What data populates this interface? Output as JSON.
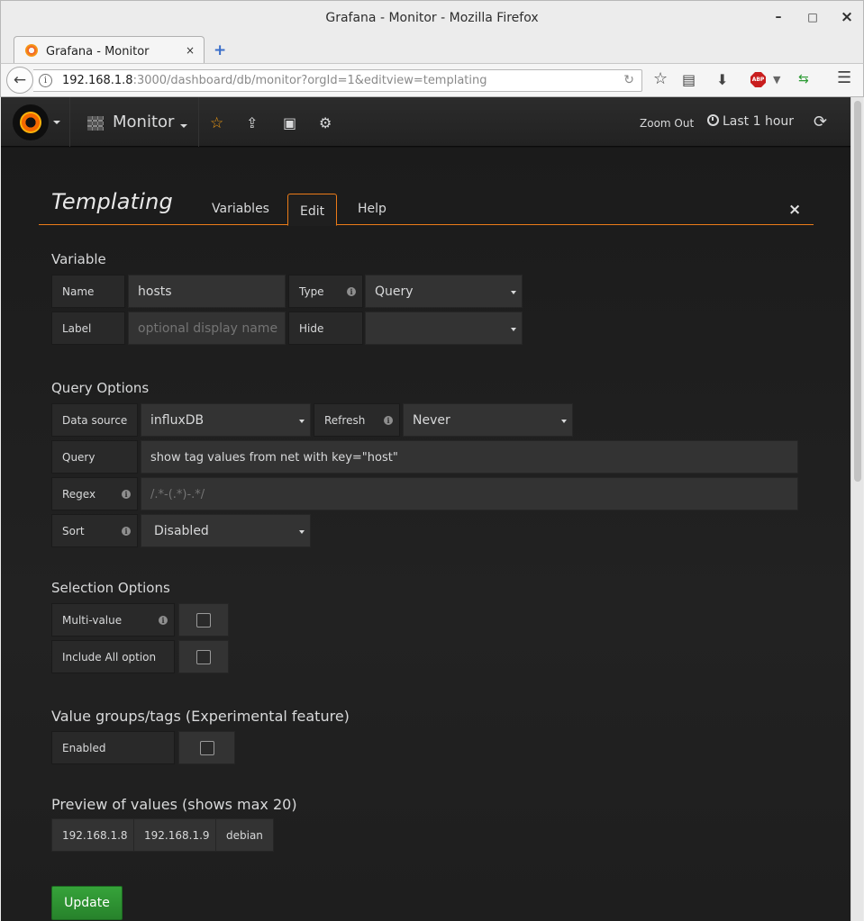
{
  "window": {
    "title": "Grafana - Monitor - Mozilla Firefox",
    "minimize": "–",
    "maximize": "□",
    "close": "×"
  },
  "browser": {
    "tab_label": "Grafana - Monitor",
    "tab_close": "×",
    "new_tab": "+",
    "back": "←",
    "url_host": "192.168.1.8",
    "url_rest": ":3000/dashboard/db/monitor?orgId=1&editview=templating",
    "reload": "↻",
    "icons": [
      "bookmark-star-icon",
      "reader-view-icon",
      "download-icon",
      "adblock-plus-icon",
      "sync-arrows-icon",
      "hamburger-menu-icon"
    ],
    "abp_label": "ABP"
  },
  "topnav": {
    "dashboard_title": "Monitor",
    "zoom_out": "Zoom Out",
    "time_range": "Last 1 hour"
  },
  "templating": {
    "title": "Templating",
    "tabs": {
      "variables": "Variables",
      "edit": "Edit",
      "help": "Help"
    },
    "close": "×",
    "variable": {
      "heading": "Variable",
      "name_label": "Name",
      "name_value": "hosts",
      "type_label": "Type",
      "type_value": "Query",
      "label_label": "Label",
      "label_placeholder": "optional display name",
      "hide_label": "Hide",
      "hide_value": ""
    },
    "query_options": {
      "heading": "Query Options",
      "datasource_label": "Data source",
      "datasource_value": "influxDB",
      "refresh_label": "Refresh",
      "refresh_value": "Never",
      "query_label": "Query",
      "query_value": "show tag values from net with key=\"host\"",
      "regex_label": "Regex",
      "regex_placeholder": "/.*-(.*)-.*/",
      "sort_label": "Sort",
      "sort_value": "Disabled"
    },
    "selection_options": {
      "heading": "Selection Options",
      "multi_value_label": "Multi-value",
      "multi_value_checked": false,
      "include_all_label": "Include All option",
      "include_all_checked": false
    },
    "tags": {
      "heading": "Value groups/tags (Experimental feature)",
      "enabled_label": "Enabled",
      "enabled_checked": false
    },
    "preview": {
      "heading": "Preview of values (shows max 20)",
      "values": [
        "192.168.1.8",
        "192.168.1.9",
        "debian"
      ]
    },
    "update_button": "Update"
  },
  "colors": {
    "accent": "#eb7b18",
    "primary_button": "#2f9a33",
    "star": "#f39c12"
  }
}
